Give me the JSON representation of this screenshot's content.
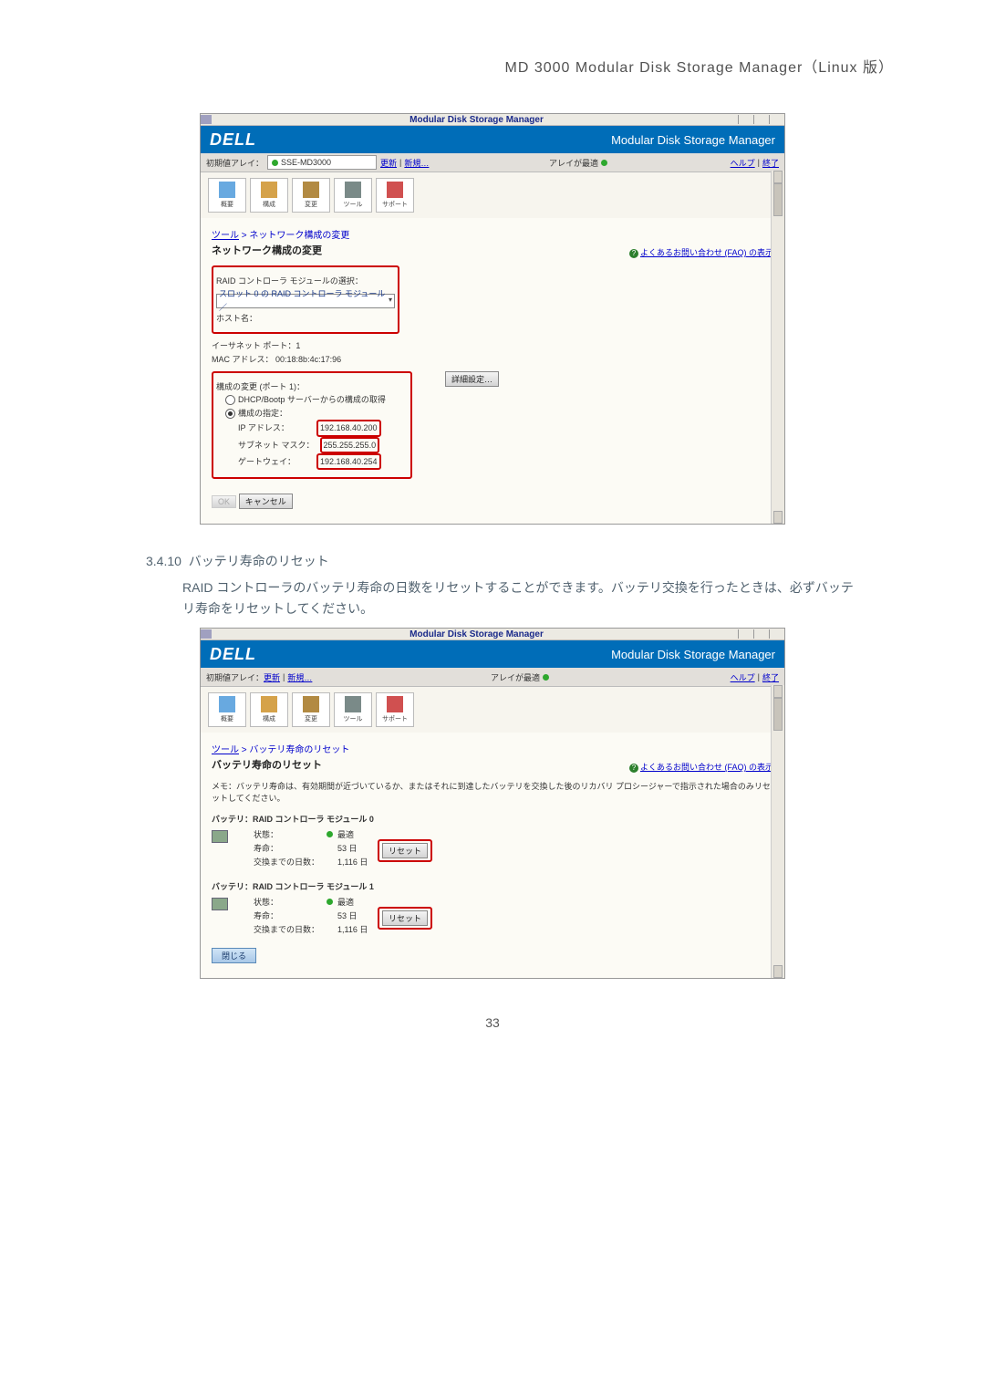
{
  "doc": {
    "header": "MD 3000 Modular Disk Storage Manager（Linux 版）",
    "section_num": "3.4.10",
    "section_title": "バッテリ寿命のリセット",
    "body": "RAID コントローラのバッテリ寿命の日数をリセットすることができます。バッテリ交換を行ったときは、必ずバッテリ寿命をリセットしてください。",
    "page_number": "33"
  },
  "app": {
    "window_title": "Modular Disk Storage Manager",
    "brand": "DELL",
    "product": "Modular Disk Storage Manager",
    "array_label": "初期値アレイ：",
    "array_name": "SSE-MD3000",
    "link_perf": "更新",
    "link_new": "新規…",
    "status_label": "アレイが最適",
    "link_help": "ヘルプ",
    "link_exit": "終了",
    "icons": {
      "summary": "概要",
      "config": "構成",
      "modify": "変更",
      "tools": "ツール",
      "support": "サポート"
    },
    "faq": "よくあるお問い合わせ (FAQ) の表示"
  },
  "shot1": {
    "breadcrumb_tool": "ツール",
    "breadcrumb_tail": "ネットワーク構成の変更",
    "heading": "ネットワーク構成の変更",
    "select_label": "RAID コントローラ モジュールの選択：",
    "select_value": "スロット 0 の RAID コントローラ モジュール　／",
    "host_label": "ホスト名：",
    "eth_label": "イーサネット ポート：1",
    "mac_label": "MAC アドレス：",
    "mac_value": "00:18:8b:4c:17:96",
    "portcfg_heading": "構成の変更 (ポート 1)：",
    "advanced_btn": "詳細設定…",
    "opt_dhcp": "DHCP/Bootp サーバーからの構成の取得",
    "opt_manual": "構成の指定：",
    "ip_label": "IP アドレス：",
    "ip_value": "192.168.40.200",
    "subnet_label": "サブネット マスク：",
    "subnet_value": "255.255.255.0",
    "gateway_label": "ゲートウェイ：",
    "gateway_value": "192.168.40.254",
    "ok_btn": "OK",
    "cancel_btn": "キャンセル"
  },
  "shot2": {
    "breadcrumb_tool": "ツール",
    "breadcrumb_tail": "バッテリ寿命のリセット",
    "heading": "バッテリ寿命のリセット",
    "note": "メモ：バッテリ寿命は、有効期間が近づいているか、またはそれに到達したバッテリを交換した後のリカバリ プロシージャーで指示された場合のみリセットしてください。",
    "batt0_head": "バッテリ：RAID コントローラ モジュール 0",
    "batt1_head": "バッテリ：RAID コントローラ モジュール 1",
    "status_label": "状態：",
    "status_value": "最適",
    "life_label": "寿命：",
    "life_value": "53 日",
    "exchange_label": "交換までの日数：",
    "exchange_value": "1,116 日",
    "reset_btn": "リセット",
    "close_btn": "閉じる"
  }
}
